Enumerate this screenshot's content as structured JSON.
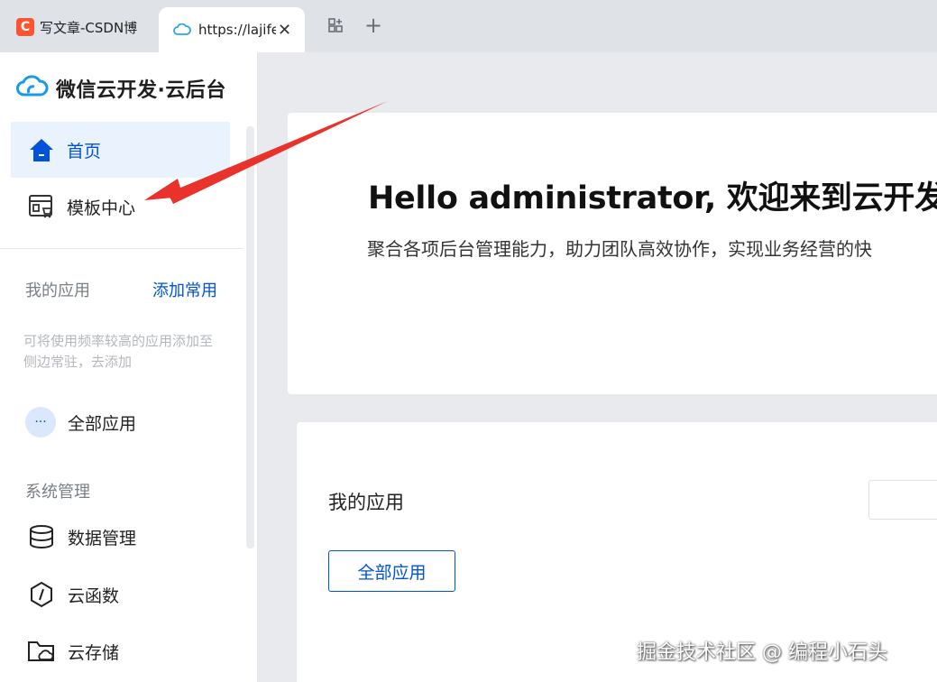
{
  "browser": {
    "tabs": [
      {
        "label": "写文章-CSDN博",
        "favicon": "C",
        "active": false
      },
      {
        "label": "https://lajife",
        "active": true
      }
    ],
    "close_glyph": "✕",
    "new_tab_glyph": "+"
  },
  "sidebar": {
    "brand": "微信云开发·云后台",
    "nav": [
      {
        "label": "首页",
        "icon": "home-icon",
        "active": true
      },
      {
        "label": "模板中心",
        "icon": "template-icon",
        "active": false
      }
    ],
    "my_apps": {
      "heading": "我的应用",
      "action": "添加常用",
      "hint": "可将使用频率较高的应用添加至侧边常驻，去添加"
    },
    "all_apps": {
      "label": "全部应用",
      "icon_glyph": "···"
    },
    "system": {
      "heading": "系统管理",
      "items": [
        {
          "label": "数据管理",
          "icon": "database-icon"
        },
        {
          "label": "云函数",
          "icon": "function-icon"
        },
        {
          "label": "云存储",
          "icon": "storage-icon"
        }
      ]
    }
  },
  "main": {
    "hero": {
      "title": "Hello administrator, 欢迎来到云开发",
      "subtitle": "聚合各项后台管理能力，助力团队高效协作，实现业务经营的快"
    },
    "apps": {
      "title": "我的应用",
      "button": "全部应用"
    }
  },
  "watermark": "掘金技术社区 @ 编程小石头",
  "colors": {
    "accent": "#0052d9",
    "annotation": "#e8322b",
    "csdn": "#fc5531"
  }
}
